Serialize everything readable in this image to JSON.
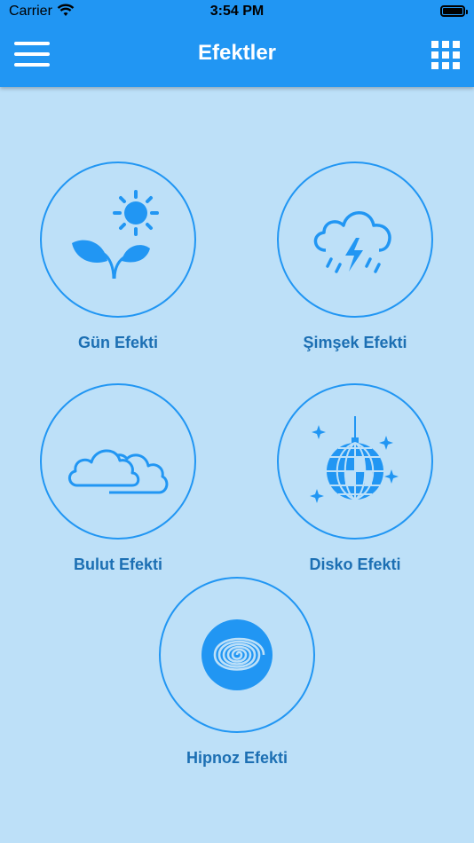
{
  "status_bar": {
    "carrier": "Carrier",
    "time": "3:54 PM"
  },
  "header": {
    "title": "Efektler"
  },
  "effects": [
    {
      "label": "Gün Efekti",
      "icon": "sun-plant-icon"
    },
    {
      "label": "Şimşek Efekti",
      "icon": "thunderstorm-icon"
    },
    {
      "label": "Bulut Efekti",
      "icon": "clouds-icon"
    },
    {
      "label": "Disko Efekti",
      "icon": "disco-ball-icon"
    },
    {
      "label": "Hipnoz Efekti",
      "icon": "hypnosis-spiral-icon"
    }
  ],
  "colors": {
    "header_bg": "#2196f3",
    "page_bg": "#bde0f8",
    "accent": "#2196f3",
    "label": "#1c6fb3"
  }
}
